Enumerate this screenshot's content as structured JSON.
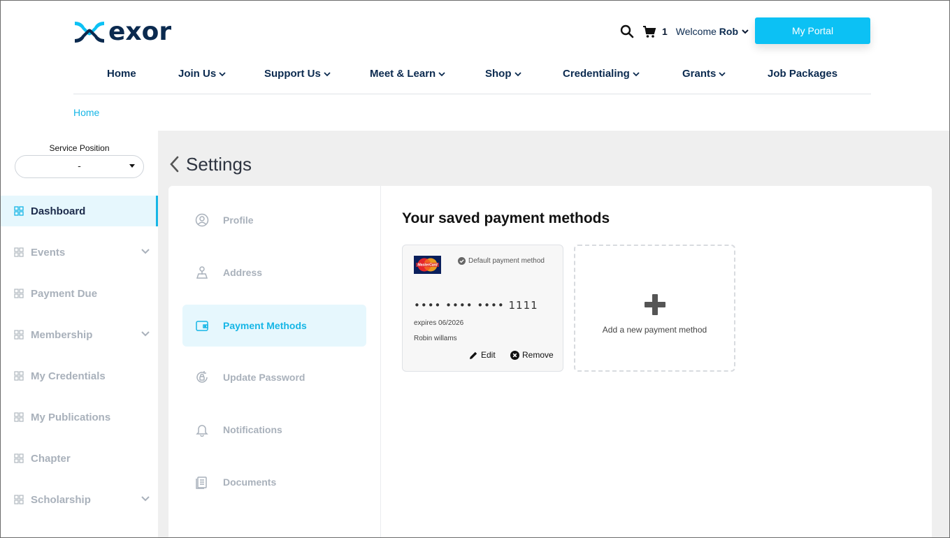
{
  "brand": {
    "name": "exor",
    "accent": "#0cc1f4",
    "navy": "#0b2a4f"
  },
  "topbar": {
    "cart_count": "1",
    "welcome_prefix": "Welcome",
    "welcome_user": "Rob",
    "portal_button": "My Portal"
  },
  "nav": {
    "items": [
      {
        "label": "Home"
      },
      {
        "label": "Join Us"
      },
      {
        "label": "Support Us"
      },
      {
        "label": "Meet & Learn"
      },
      {
        "label": "Shop"
      },
      {
        "label": "Credentialing"
      },
      {
        "label": "Grants"
      },
      {
        "label": "Job Packages"
      }
    ]
  },
  "breadcrumb": {
    "home": "Home"
  },
  "sidebar": {
    "service_label": "Service Position",
    "service_value": "-",
    "items": [
      {
        "label": "Dashboard"
      },
      {
        "label": "Events"
      },
      {
        "label": "Payment Due"
      },
      {
        "label": "Membership"
      },
      {
        "label": "My Credentials"
      },
      {
        "label": "My Publications"
      },
      {
        "label": "Chapter"
      },
      {
        "label": "Scholarship"
      }
    ]
  },
  "main": {
    "title": "Settings",
    "tabs": [
      {
        "label": "Profile"
      },
      {
        "label": "Address"
      },
      {
        "label": "Payment Methods"
      },
      {
        "label": "Update Password"
      },
      {
        "label": "Notifications"
      },
      {
        "label": "Documents"
      }
    ],
    "payment": {
      "heading": "Your saved payment methods",
      "card": {
        "brand_text": "MasterCard",
        "default_label": "Default payment method",
        "masked_number": "•••• •••• •••• 1111",
        "expires": "expires 06/2026",
        "holder": "Robin willams",
        "edit_label": "Edit",
        "remove_label": "Remove"
      },
      "add_label": "Add a new payment method"
    }
  }
}
